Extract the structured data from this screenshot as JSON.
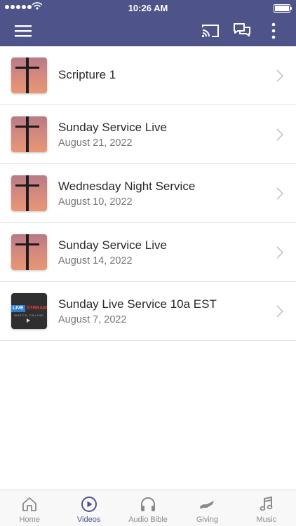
{
  "status": {
    "time": "10:26 AM"
  },
  "colors": {
    "accent": "#4e5389",
    "tab_inactive": "#8a8a8a"
  },
  "appbar": {
    "icons": [
      "menu-icon",
      "cast-icon",
      "chat-icon",
      "more-vertical-icon"
    ]
  },
  "list": {
    "items": [
      {
        "title": "Scripture 1",
        "date": "",
        "thumb": "cross"
      },
      {
        "title": "Sunday Service Live",
        "date": "August 21, 2022",
        "thumb": "cross"
      },
      {
        "title": "Wednesday Night Service",
        "date": "August 10, 2022",
        "thumb": "cross"
      },
      {
        "title": "Sunday Service Live",
        "date": "August 14, 2022",
        "thumb": "cross"
      },
      {
        "title": "Sunday Live Service 10a EST",
        "date": "August 7, 2022",
        "thumb": "livestream"
      }
    ],
    "livestream_thumb": {
      "word1": "LIVE",
      "word2": "STREAM",
      "sub": "WATCH ONLINE"
    }
  },
  "tabs": [
    {
      "label": "Home",
      "icon": "home-icon",
      "active": false
    },
    {
      "label": "Videos",
      "icon": "play-circle-icon",
      "active": true
    },
    {
      "label": "Audio Bible",
      "icon": "headphones-icon",
      "active": false
    },
    {
      "label": "Giving",
      "icon": "giving-hand-icon",
      "active": false
    },
    {
      "label": "Music",
      "icon": "music-note-icon",
      "active": false
    }
  ]
}
